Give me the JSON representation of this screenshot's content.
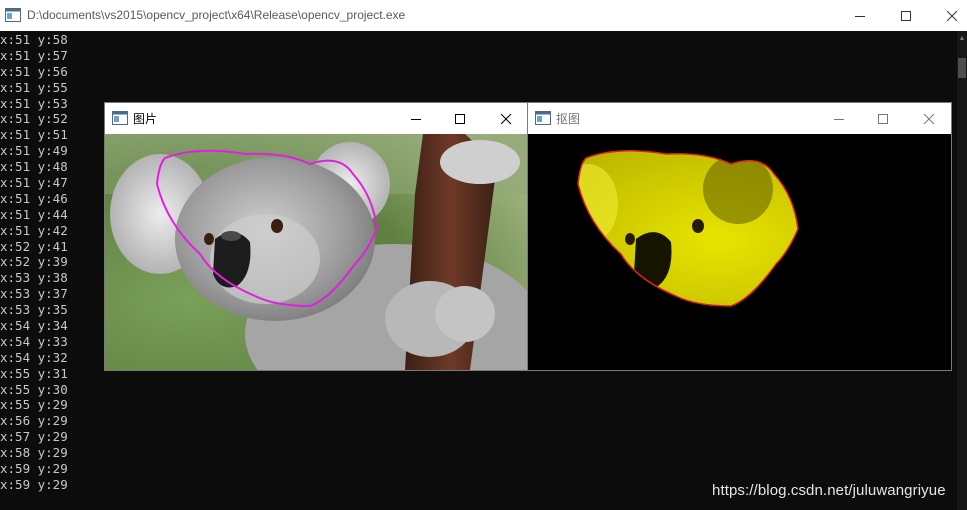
{
  "console": {
    "title": "D:\\documents\\vs2015\\opencv_project\\x64\\Release\\opencv_project.exe",
    "lines": [
      "x:51 y:58",
      "x:51 y:57",
      "x:51 y:56",
      "x:51 y:55",
      "x:51 y:53",
      "x:51 y:52",
      "x:51 y:51",
      "x:51 y:49",
      "x:51 y:48",
      "x:51 y:47",
      "x:51 y:46",
      "x:51 y:44",
      "x:51 y:42",
      "x:52 y:41",
      "x:52 y:39",
      "x:53 y:38",
      "x:53 y:37",
      "x:53 y:35",
      "x:54 y:34",
      "x:54 y:33",
      "x:54 y:32",
      "x:55 y:31",
      "x:55 y:30",
      "x:55 y:29",
      "x:56 y:29",
      "x:57 y:29",
      "x:58 y:29",
      "x:59 y:29",
      "x:59 y:29"
    ]
  },
  "window_image": {
    "title": "图片"
  },
  "window_cutout": {
    "title": "抠图"
  },
  "icons": {
    "app": "console-app-icon",
    "minimize": "minimize-icon",
    "maximize": "maximize-icon",
    "close": "close-icon"
  },
  "colors": {
    "contour": "#e020e0",
    "cutout_edge": "#e02020",
    "cutout_fill": "#d8d400"
  },
  "watermark": "https://blog.csdn.net/juluwangriyue"
}
